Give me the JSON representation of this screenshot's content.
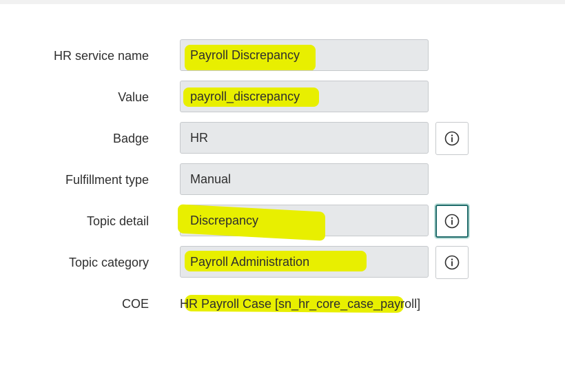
{
  "form": {
    "fields": [
      {
        "label": "HR service name",
        "value": "Payroll Discrepancy"
      },
      {
        "label": "Value",
        "value": "payroll_discrepancy"
      },
      {
        "label": "Badge",
        "value": "HR"
      },
      {
        "label": "Fulfillment type",
        "value": "Manual"
      },
      {
        "label": "Topic detail",
        "value": "Discrepancy"
      },
      {
        "label": "Topic category",
        "value": "Payroll Administration"
      }
    ],
    "coe": {
      "label": "COE",
      "value": "HR Payroll Case [sn_hr_core_case_payroll]"
    },
    "info_icon": "info-circle-icon"
  },
  "colors": {
    "highlight": "#e8ef00",
    "field_bg": "#e6e8ea",
    "focus_ring": "#1f6b6a"
  }
}
